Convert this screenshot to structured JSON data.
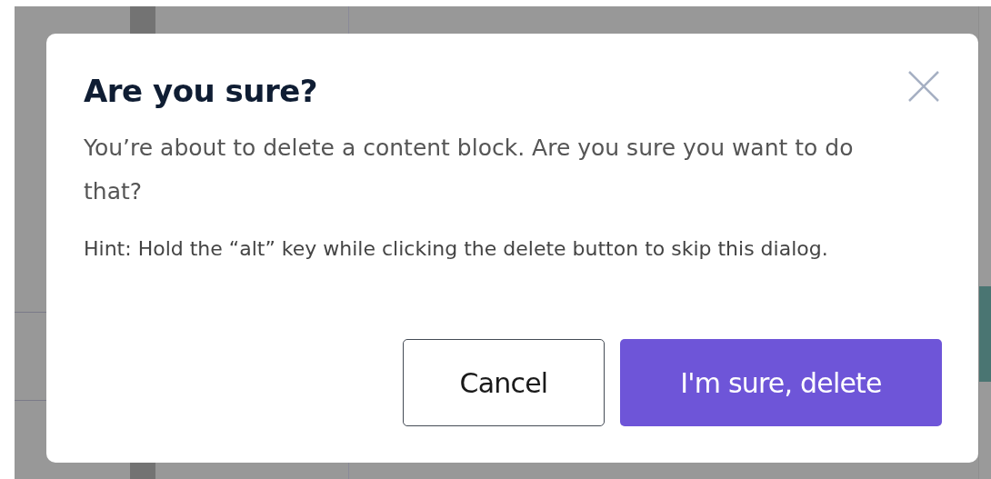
{
  "dialog": {
    "title": "Are you sure?",
    "message": "You’re about to delete a content block. Are you sure you want to do that?",
    "hint": "Hint: Hold the “alt” key while clicking the delete button to skip this dialog.",
    "buttons": [
      {
        "label": "Cancel",
        "kind": "secondary"
      },
      {
        "label": "I'm sure, delete",
        "kind": "primary"
      }
    ]
  }
}
